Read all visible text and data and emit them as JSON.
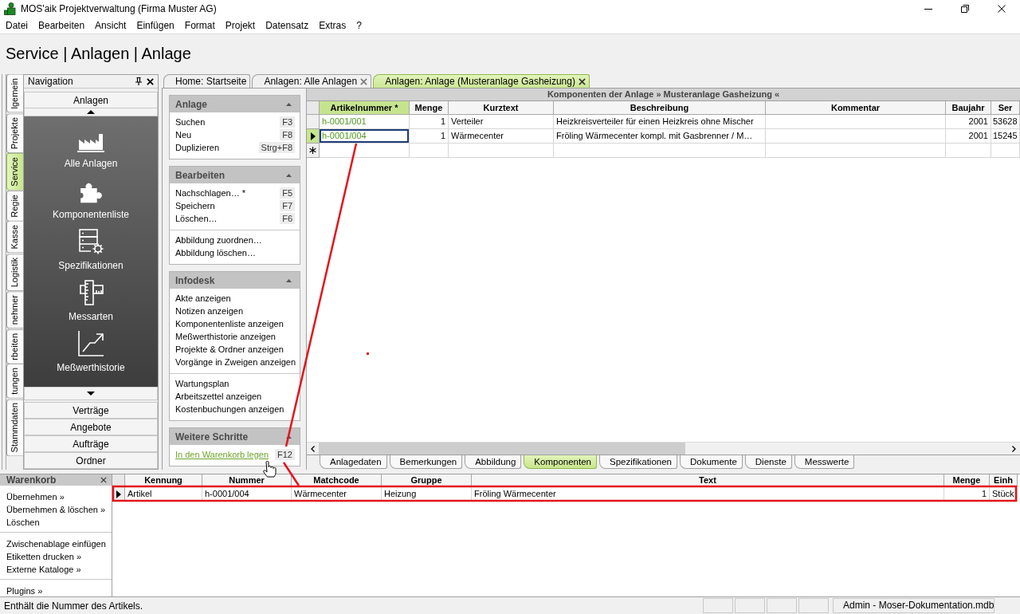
{
  "window": {
    "title": "MOS'aik Projektverwaltung (Firma Muster AG)"
  },
  "menu": [
    "Datei",
    "Bearbeiten",
    "Ansicht",
    "Einfügen",
    "Format",
    "Projekt",
    "Datensatz",
    "Extras",
    "?"
  ],
  "breadcrumb": "Service | Anlagen | Anlage",
  "side_tabs": [
    {
      "label": "lgemein",
      "selected": false
    },
    {
      "label": "Projekte",
      "selected": false
    },
    {
      "label": "Service",
      "selected": true
    },
    {
      "label": "Regie",
      "selected": false
    },
    {
      "label": "Kasse",
      "selected": false
    },
    {
      "label": "Logistik",
      "selected": false
    },
    {
      "label": "nehmer",
      "selected": false
    },
    {
      "label": "rbeiten",
      "selected": false
    },
    {
      "label": "tungen",
      "selected": false
    },
    {
      "label": "Stammdaten",
      "selected": false
    }
  ],
  "navigation": {
    "title": "Navigation",
    "group": "Anlagen",
    "items": [
      {
        "label": "Alle Anlagen",
        "kind": "factory"
      },
      {
        "label": "Komponentenliste",
        "kind": "puzzle"
      },
      {
        "label": "Spezifikationen",
        "kind": "specs"
      },
      {
        "label": "Messarten",
        "kind": "ruler"
      },
      {
        "label": "Meßwerthistorie",
        "kind": "chart"
      }
    ],
    "other_groups": [
      "Verträge",
      "Angebote",
      "Aufträge",
      "Ordner"
    ]
  },
  "document_tabs": [
    {
      "label": "Home: Startseite",
      "selected": false,
      "closable": false
    },
    {
      "label": "Anlagen: Alle Anlagen",
      "selected": false,
      "closable": true
    },
    {
      "label": "Anlagen: Anlage (Musteranlage Gasheizung)",
      "selected": true,
      "closable": true
    }
  ],
  "task_pane": [
    {
      "title": "Anlage",
      "groups": [
        [
          {
            "label": "Suchen",
            "shortcut": "F3",
            "kind": "command"
          },
          {
            "label": "Neu",
            "shortcut": "F8",
            "kind": "command"
          },
          {
            "label": "Duplizieren",
            "shortcut": "Strg+F8",
            "kind": "command"
          }
        ]
      ]
    },
    {
      "title": "Bearbeiten",
      "groups": [
        [
          {
            "label": "Nachschlagen… *",
            "shortcut": "F5",
            "kind": "command"
          },
          {
            "label": "Speichern",
            "shortcut": "F7",
            "kind": "command"
          },
          {
            "label": "Löschen…",
            "shortcut": "F6",
            "kind": "command"
          }
        ],
        [
          {
            "label": "Abbildung zuordnen…",
            "kind": "command"
          },
          {
            "label": "Abbildung löschen…",
            "kind": "command"
          }
        ]
      ]
    },
    {
      "title": "Infodesk",
      "groups": [
        [
          {
            "label": "Akte anzeigen",
            "kind": "command"
          },
          {
            "label": "Notizen anzeigen",
            "kind": "command"
          },
          {
            "label": "Komponentenliste anzeigen",
            "kind": "command"
          },
          {
            "label": "Meßwerthistorie anzeigen",
            "kind": "command"
          },
          {
            "label": "Projekte & Ordner anzeigen",
            "kind": "command"
          },
          {
            "label": "Vorgänge in Zweigen anzeigen",
            "kind": "command"
          }
        ],
        [
          {
            "label": "Wartungsplan",
            "kind": "command"
          },
          {
            "label": "Arbeitszettel anzeigen",
            "kind": "command"
          },
          {
            "label": "Kostenbuchungen anzeigen",
            "kind": "command"
          }
        ]
      ]
    },
    {
      "title": "Weitere Schritte",
      "groups": [
        [
          {
            "label": "In den Warenkorb legen",
            "shortcut": "F12",
            "kind": "link"
          }
        ]
      ]
    }
  ],
  "components": {
    "title": "Komponenten der Anlage » Musteranlage Gasheizung «",
    "active": true,
    "columns": [
      {
        "label": "Artikelnummer *",
        "kind": "link",
        "selected": true
      },
      {
        "label": "Menge",
        "kind": "number",
        "selected": false
      },
      {
        "label": "Kurztext",
        "kind": "text",
        "selected": false
      },
      {
        "label": "Beschreibung",
        "kind": "text",
        "selected": false
      },
      {
        "label": "Kommentar",
        "kind": "text",
        "selected": false
      },
      {
        "label": "Baujahr",
        "kind": "number",
        "selected": false
      },
      {
        "label": "Ser",
        "kind": "text",
        "selected": false
      }
    ],
    "rows": [
      {
        "selected": false,
        "cells": [
          "h-0001/001",
          "1",
          "Verteiler",
          "Heizkreisverteiler für einen Heizkreis ohne Mischer",
          null,
          "2001",
          "53628"
        ]
      },
      {
        "selected": true,
        "cells": [
          "h-0001/004",
          "1",
          "Wärmecenter",
          "Fröling Wärmecenter kompl. mit Gasbrenner / M…",
          null,
          "2001",
          "15245"
        ]
      }
    ],
    "new_row": true,
    "detail_tabs": [
      {
        "label": "Anlagedaten",
        "selected": false
      },
      {
        "label": "Bemerkungen",
        "selected": false
      },
      {
        "label": "Abbildung",
        "selected": false
      },
      {
        "label": "Komponenten",
        "selected": true
      },
      {
        "label": "Spezifikationen",
        "selected": false
      },
      {
        "label": "Dokumente",
        "selected": false
      },
      {
        "label": "Dienste",
        "selected": false
      },
      {
        "label": "Messwerte",
        "selected": false
      }
    ]
  },
  "warenkorb": {
    "title": "Warenkorb",
    "actions": [
      [
        "Übernehmen »",
        "Übernehmen & löschen »",
        "Löschen"
      ],
      [
        "Zwischenablage einfügen",
        "Etiketten drucken »",
        "Externe Kataloge »"
      ],
      [
        "Plugins »"
      ]
    ],
    "active": false,
    "columns": [
      {
        "label": "Kennung",
        "kind": "text"
      },
      {
        "label": "Nummer",
        "kind": "text"
      },
      {
        "label": "Matchcode",
        "kind": "text"
      },
      {
        "label": "Gruppe",
        "kind": "text"
      },
      {
        "label": "Text",
        "kind": "text"
      },
      {
        "label": "Menge",
        "kind": "number"
      },
      {
        "label": "Einh",
        "kind": "text"
      }
    ],
    "rows": [
      {
        "selected": true,
        "cells": [
          "Artikel",
          "h-0001/004",
          "Wärmecenter",
          "Heizung",
          "Fröling Wärmecenter",
          "1",
          "Stück"
        ]
      }
    ]
  },
  "status_bar": {
    "message": "Enthält die Nummer des Artikels.",
    "info": "Admin - Moser-Dokumentation.mdb"
  }
}
